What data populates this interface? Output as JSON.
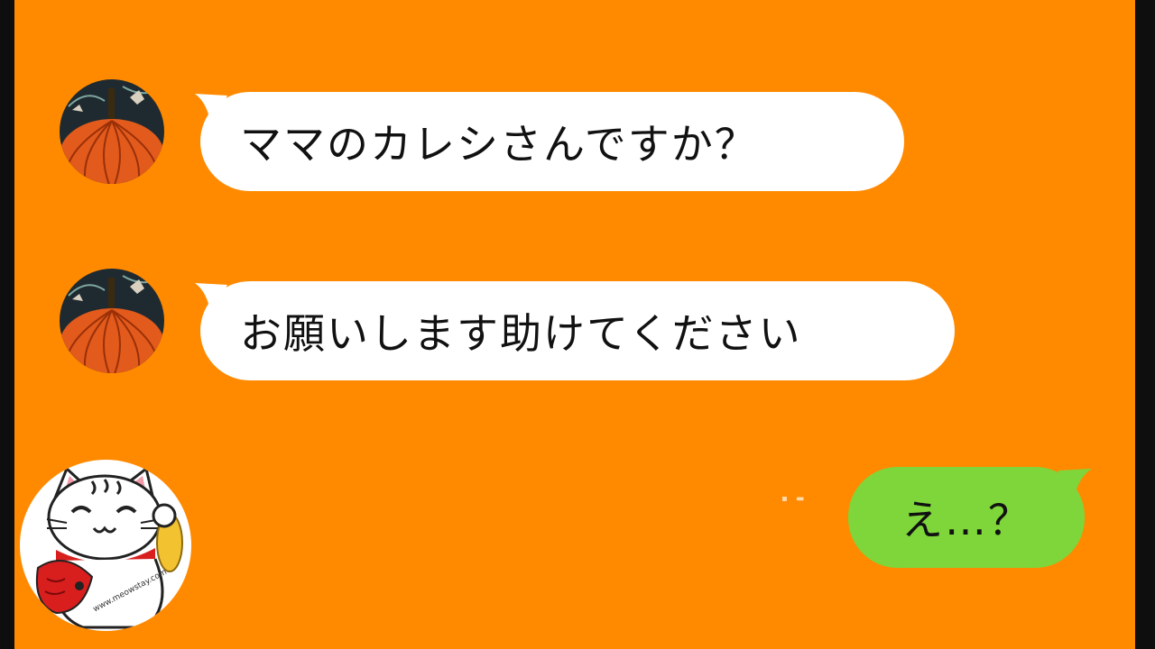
{
  "messages": [
    {
      "direction": "incoming",
      "text": "ママのカレシさんですか？",
      "avatar_icon": "pumpkin-avatar-icon"
    },
    {
      "direction": "incoming",
      "text": "お願いします助けてください",
      "avatar_icon": "pumpkin-avatar-icon"
    },
    {
      "direction": "outgoing",
      "text": "え…？"
    }
  ],
  "watermark": {
    "icon": "maneki-neko-cat-logo-icon",
    "text": "www.meowstay.com"
  },
  "colors": {
    "background": "#ff8a00",
    "incoming_bubble": "#ffffff",
    "outgoing_bubble": "#7ed63a",
    "frame": "#0e0e0e"
  }
}
